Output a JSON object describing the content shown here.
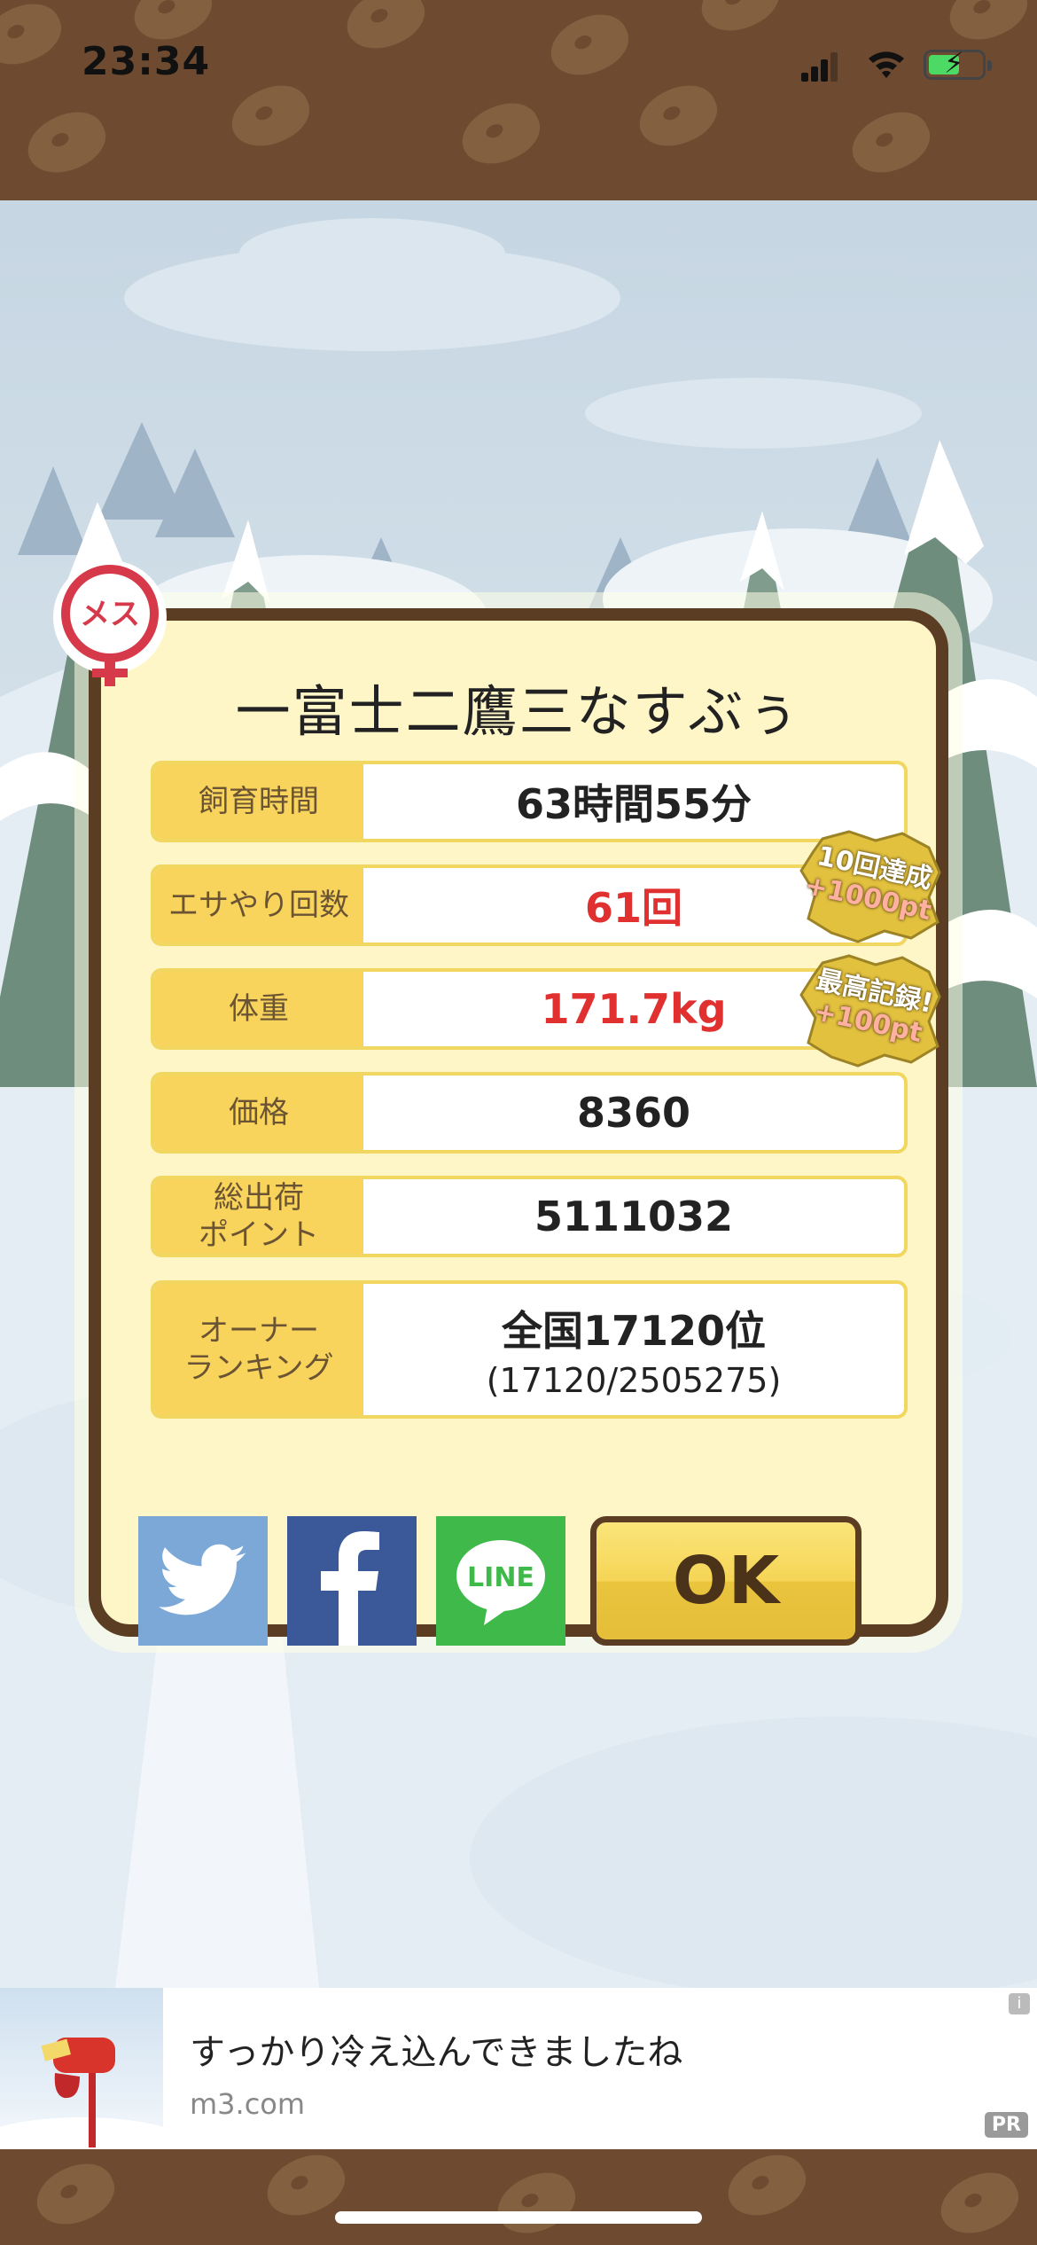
{
  "status_bar": {
    "time": "23:34"
  },
  "result": {
    "name": "一富士二鷹三なすぶぅ",
    "rows": [
      {
        "label": "飼育時間",
        "value": "63時間55分"
      },
      {
        "label": "エサやり回数",
        "value": "61回"
      },
      {
        "label": "体重",
        "value": "171.7kg"
      },
      {
        "label": "価格",
        "value": "8360"
      },
      {
        "label": "総出荷\nポイント",
        "value": "5111032"
      },
      {
        "label": "オーナー\nランキング",
        "value": "全国17120位",
        "sub": "(17120/2505275)"
      }
    ],
    "badges": [
      {
        "line1": "10回達成",
        "line2": "+1000pt"
      },
      {
        "line1": "最高記録!",
        "line2": "+100pt"
      }
    ],
    "gender_label": "メス",
    "ok_label": "OK",
    "line_label": "LINE"
  },
  "ad": {
    "text": "すっかり冷え込んできましたね",
    "domain": "m3.com",
    "pr": "PR",
    "info": "i"
  },
  "colors": {
    "accent_yellow": "#f8d45c",
    "border_brown": "#5a3d22",
    "highlight_red": "#e03030",
    "panel_bg": "#fff6c8"
  }
}
